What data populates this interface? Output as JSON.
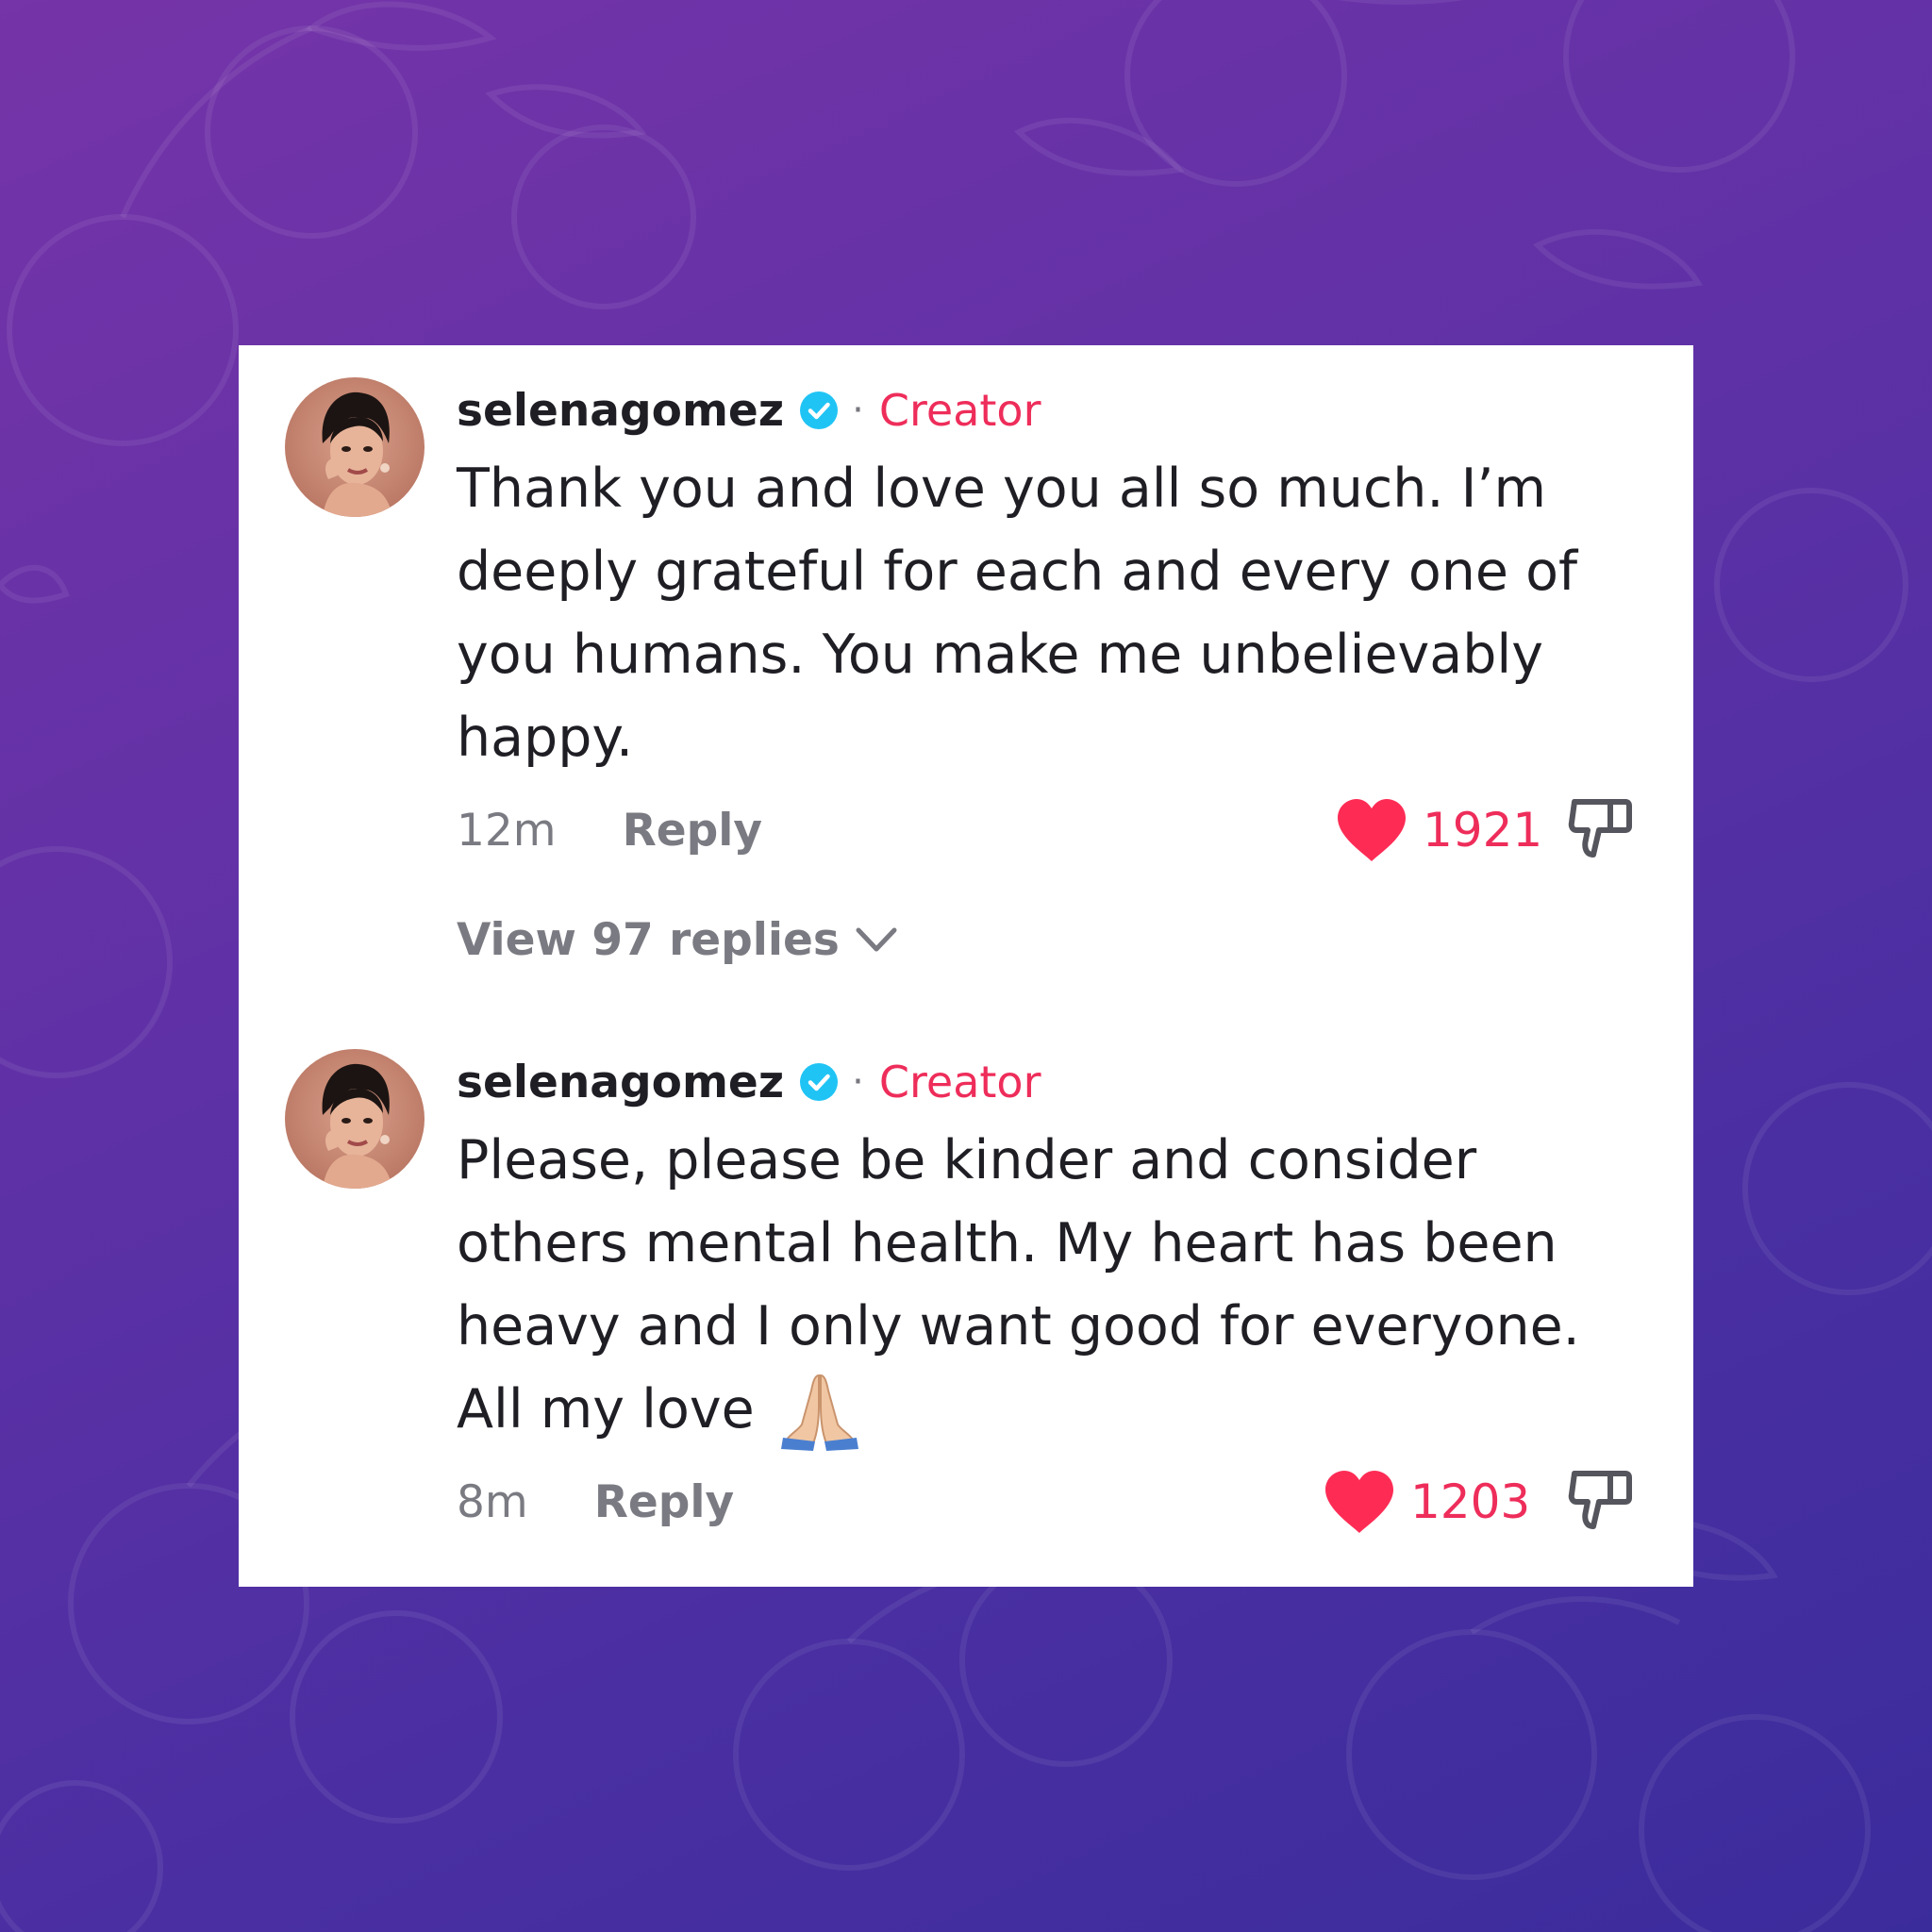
{
  "colors": {
    "background_start": "#7534a8",
    "background_end": "#3b2c9c",
    "accent_pink": "#ee2d5a",
    "verified_blue": "#20c4f4",
    "text_primary": "#1e1e24",
    "text_secondary": "#7a7a82"
  },
  "comments": [
    {
      "avatar": "profile-photo",
      "username": "selenagomez",
      "verified_icon": "verified-badge-icon",
      "separator": "·",
      "badge": "Creator",
      "text": "Thank you and love you all so much. I’m deeply grateful for each and every one of you humans. You make me unbelievably happy.",
      "time": "12m",
      "reply_label": "Reply",
      "likes": "1921",
      "like_icon": "heart-icon",
      "dislike_icon": "thumbs-down-icon",
      "view_replies": "View 97 replies",
      "view_replies_icon": "chevron-down-icon"
    },
    {
      "avatar": "profile-photo",
      "username": "selenagomez",
      "verified_icon": "verified-badge-icon",
      "separator": "·",
      "badge": "Creator",
      "text": "Please, please be kinder and consider others mental health. My heart has been heavy and I only want good for everyone. All my love",
      "emoji": "🙏",
      "time": "8m",
      "reply_label": "Reply",
      "likes": "1203",
      "like_icon": "heart-icon",
      "dislike_icon": "thumbs-down-icon"
    }
  ]
}
